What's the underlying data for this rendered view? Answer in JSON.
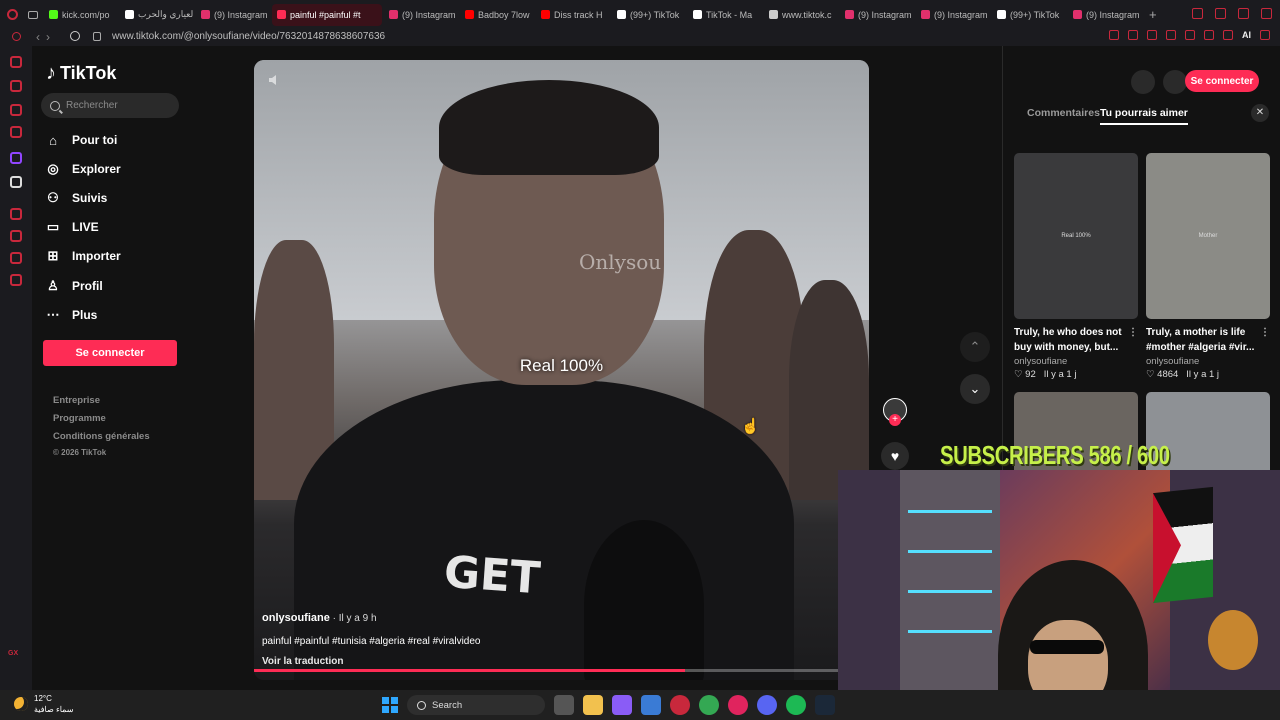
{
  "browser": {
    "tabs": [
      {
        "label": "kick.com/po",
        "color": "#53fc18"
      },
      {
        "label": "العياري والحرب",
        "color": "#ffffff"
      },
      {
        "label": "(9) Instagram",
        "color": "#e1306c"
      },
      {
        "label": "painful #painful #t",
        "color": "#fe2c55",
        "active": true
      },
      {
        "label": "(9) Instagram",
        "color": "#e1306c"
      },
      {
        "label": "Badboy 7low",
        "color": "#ff0000"
      },
      {
        "label": "Diss track H",
        "color": "#ff0000"
      },
      {
        "label": "(99+) TikTok",
        "color": "#ffffff"
      },
      {
        "label": "TikTok - Ma",
        "color": "#ffffff"
      },
      {
        "label": "www.tiktok.c",
        "color": "#cccccc"
      },
      {
        "label": "(9) Instagram",
        "color": "#e1306c"
      },
      {
        "label": "(9) Instagram",
        "color": "#e1306c"
      },
      {
        "label": "(99+) TikTok",
        "color": "#ffffff"
      },
      {
        "label": "(9) Instagram",
        "color": "#e1306c"
      }
    ],
    "url": "www.tiktok.com/@onlysoufiane/video/7632014878638607636",
    "ai_label": "AI"
  },
  "sidebar": {
    "logo": "TikTok",
    "search_placeholder": "Rechercher",
    "items": [
      {
        "label": "Pour toi",
        "icon": "home-icon"
      },
      {
        "label": "Explorer",
        "icon": "compass-icon"
      },
      {
        "label": "Suivis",
        "icon": "user-icon"
      },
      {
        "label": "LIVE",
        "icon": "live-icon"
      },
      {
        "label": "Importer",
        "icon": "upload-icon"
      },
      {
        "label": "Profil",
        "icon": "profile-icon"
      },
      {
        "label": "Plus",
        "icon": "more-icon"
      }
    ],
    "login_label": "Se connecter",
    "footer": [
      "Entreprise",
      "Programme",
      "Conditions générales",
      "© 2026 TikTok"
    ]
  },
  "video": {
    "caption": "Real 100%",
    "watermark": "Onlysou",
    "author": "onlysoufiane",
    "posted": " · Il y a 9 h",
    "description": "painful #painful #tunisia #algeria #real #viralvideo",
    "translate": "Voir la traduction",
    "progress": 0.7
  },
  "panel": {
    "login_label": "Se connecter",
    "tab_comments": "Commentaires",
    "tab_suggested": "Tu pourrais aimer",
    "cards": [
      {
        "title": "Truly, he who does not buy with money, but...",
        "user": "onlysoufiane",
        "likes": "92",
        "age": "Il y a 1 j",
        "thumb_label": "Real 100%",
        "thumb_color": "#3a3a3c"
      },
      {
        "title": "Truly, a mother is life #mother #algeria #vir...",
        "user": "onlysoufiane",
        "likes": "4864",
        "age": "Il y a 1 j",
        "thumb_label": "Mother",
        "thumb_color": "#8b8b86"
      }
    ]
  },
  "overlay": {
    "subscribers": "SUBSCRIBERS 586 / 600"
  },
  "taskbar": {
    "temp": "12°C",
    "weather_desc": "سماء صافية",
    "search_label": "Search"
  }
}
